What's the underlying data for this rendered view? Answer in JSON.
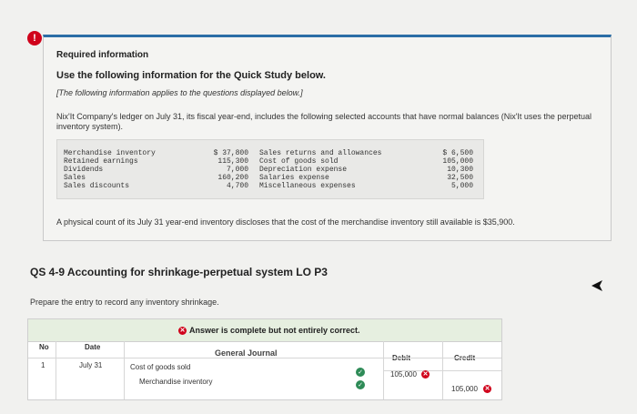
{
  "alert": {
    "icon": "exclamation-icon",
    "glyph": "!",
    "color": "#d0021b"
  },
  "info": {
    "title": "Required information",
    "use_text": "Use the following information for the Quick Study below.",
    "italic": "[The following information applies to the questions displayed below.]",
    "ledger_intro": "Nix'It Company's ledger on July 31, its fiscal year-end, includes the following selected accounts that have normal balances (Nix'It uses the perpetual inventory system).",
    "ledger_left": [
      {
        "name": "Merchandise inventory",
        "value": "$ 37,800"
      },
      {
        "name": "Retained earnings",
        "value": "115,300"
      },
      {
        "name": "Dividends",
        "value": "7,000"
      },
      {
        "name": "Sales",
        "value": "160,200"
      },
      {
        "name": "Sales discounts",
        "value": "4,700"
      }
    ],
    "ledger_right": [
      {
        "name": "Sales returns and allowances",
        "value": "$  6,500"
      },
      {
        "name": "Cost of goods sold",
        "value": "105,000"
      },
      {
        "name": "Depreciation expense",
        "value": "10,300"
      },
      {
        "name": "Salaries expense",
        "value": "32,500"
      },
      {
        "name": "Miscellaneous expenses",
        "value": "5,000"
      }
    ],
    "count_text": "A physical count of its July 31 year-end inventory discloses that the cost of the merchandise inventory still available is $35,900."
  },
  "question": {
    "title": "QS 4-9 Accounting for shrinkage-perpetual system LO P3",
    "prompt": "Prepare the entry to record any inventory shrinkage."
  },
  "journal": {
    "banner": "Answer is complete but not entirely correct.",
    "heading": "General Journal",
    "columns": {
      "no": "No",
      "date": "Date",
      "debit": "Debit",
      "credit": "Credit"
    },
    "row": {
      "no": "1",
      "date": "July 31",
      "debit_account": "Cost of goods sold",
      "credit_account": "Merchandise inventory",
      "debit_value": "105,000",
      "credit_value": "105,000"
    },
    "status_colors": {
      "correct": "#2e8b57",
      "incorrect": "#d0021b"
    }
  }
}
